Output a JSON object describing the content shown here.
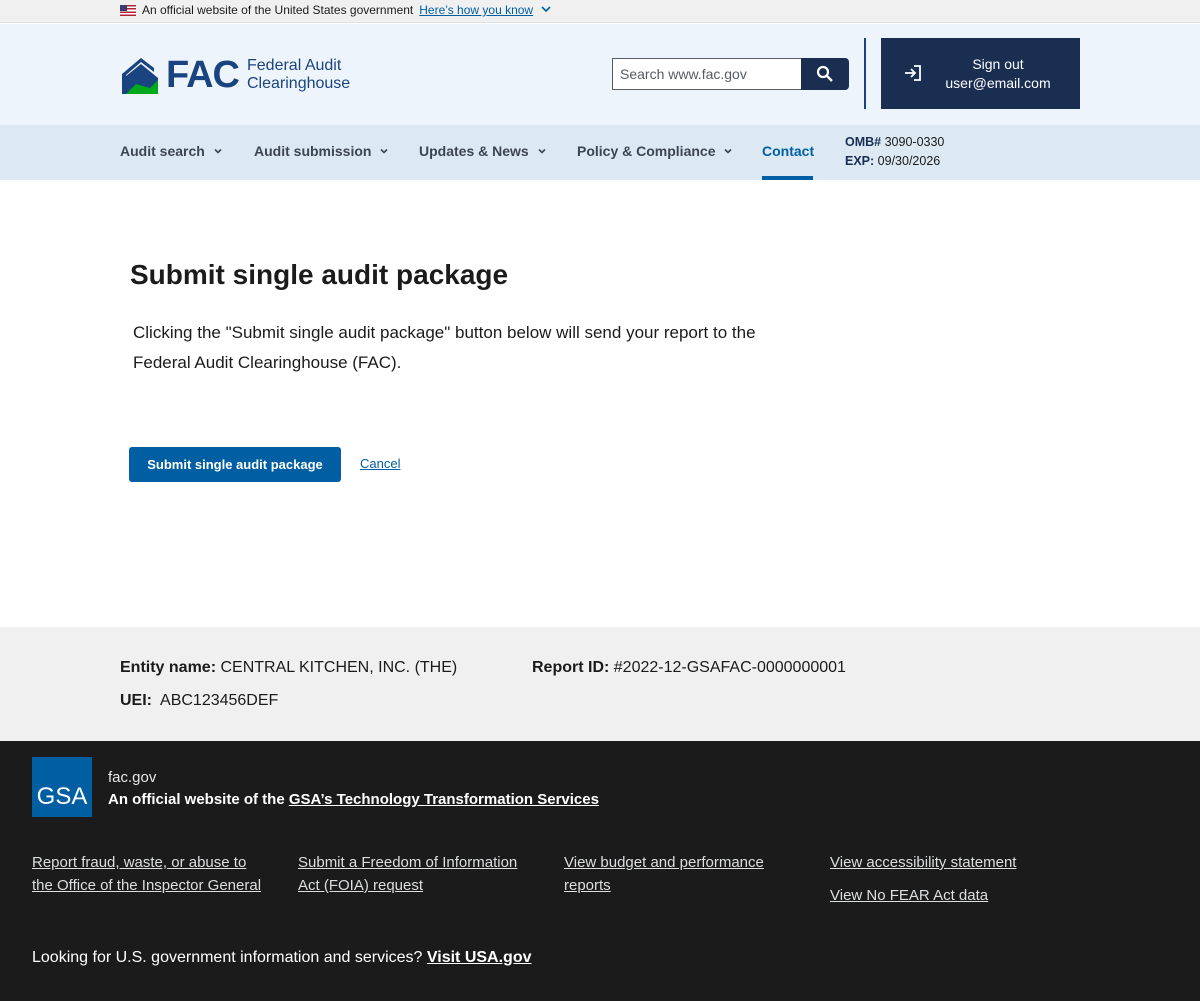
{
  "gov_banner": {
    "text": "An official website of the United States government",
    "link": "Here’s how you know"
  },
  "header": {
    "logo_text": "FAC",
    "logo_name_line1": "Federal Audit",
    "logo_name_line2": "Clearinghouse",
    "search_placeholder": "Search www.fac.gov",
    "signout_label": "Sign out",
    "user_email": "user@email.com"
  },
  "nav": {
    "items": [
      {
        "label": "Audit search"
      },
      {
        "label": "Audit submission"
      },
      {
        "label": "Updates & News"
      },
      {
        "label": "Policy & Compliance"
      },
      {
        "label": "Contact"
      }
    ],
    "omb_label": "OMB#",
    "omb_value": "3090-0330",
    "exp_label": "EXP:",
    "exp_value": "09/30/2026"
  },
  "main": {
    "title": "Submit single audit package",
    "description": "Clicking the \"Submit single audit package\" button below will send your report to the Federal Audit Clearinghouse (FAC).",
    "submit_button": "Submit single audit package",
    "cancel_link": "Cancel"
  },
  "report_info": {
    "entity_label": "Entity name:",
    "entity_value": "CENTRAL KITCHEN, INC. (THE)",
    "report_id_label": "Report ID:",
    "report_id_value": "#2022-12-GSAFAC-0000000001",
    "uei_label": "UEI:",
    "uei_value": "ABC123456DEF"
  },
  "footer": {
    "gsa_logo_text": "GSA",
    "site": "fac.gov",
    "official_prefix": "An official website of the",
    "official_link": "GSA’s Technology Transformation Services",
    "links": [
      "Report fraud, waste, or abuse to the Office of the Inspector General",
      "Submit a Freedom of Information Act (FOIA) request",
      "View budget and performance reports",
      "View accessibility statement",
      "View No FEAR Act data"
    ],
    "usagov_prefix": "Looking for U.S. government information and services?",
    "usagov_link": "Visit USA.gov"
  },
  "colors": {
    "primary": "#005ea2",
    "navy": "#1a2e52",
    "logo_green": "#00a91c",
    "footer_bg": "#1b1b1b"
  }
}
